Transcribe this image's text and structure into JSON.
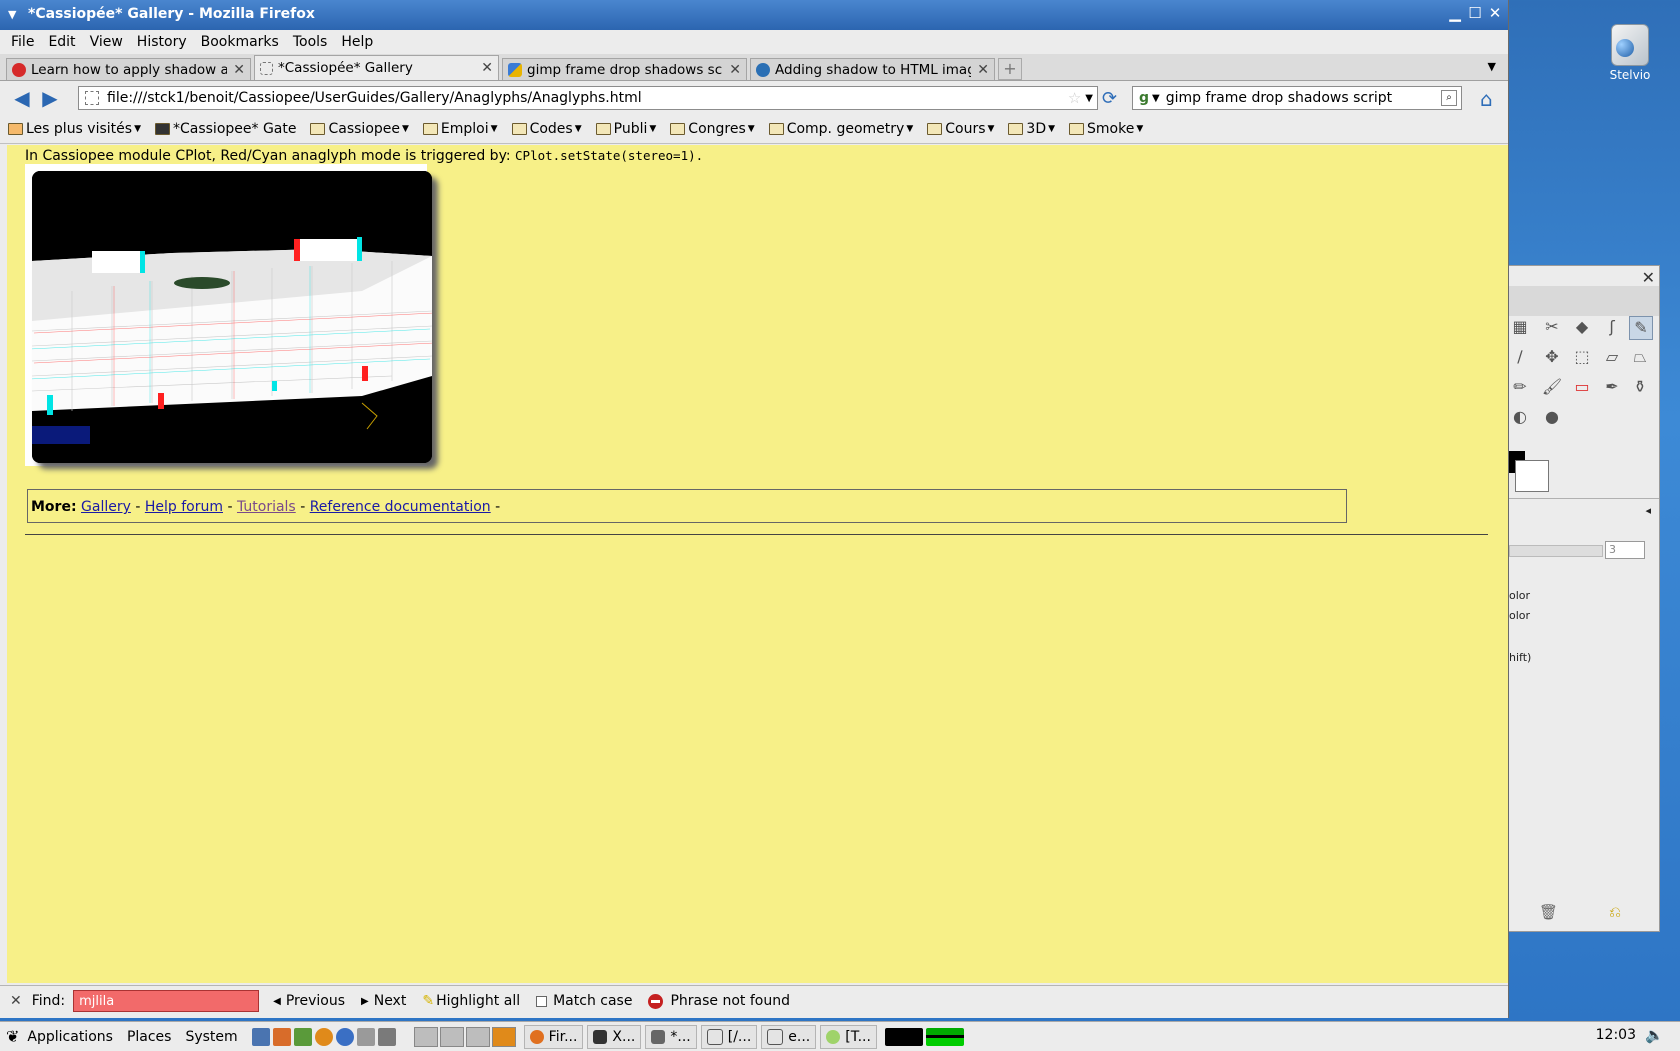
{
  "desktop": {
    "icon_label": "Stelvio"
  },
  "window": {
    "title": "*Cassiopée* Gallery - Mozilla Firefox"
  },
  "menu": [
    "File",
    "Edit",
    "View",
    "History",
    "Bookmarks",
    "Tools",
    "Help"
  ],
  "tabs": [
    {
      "label": "Learn how to apply shadow a...",
      "color": "#d62a2a"
    },
    {
      "label": "*Cassiopée* Gallery",
      "color": "#ffffff"
    },
    {
      "label": "gimp frame drop shadows sc...",
      "color": "#3a7bd5"
    },
    {
      "label": "Adding shadow to HTML imag...",
      "color": "#2a6fb4"
    }
  ],
  "nav": {
    "url": "file:///stck1/benoit/Cassiopee/UserGuides/Gallery/Anaglyphs/Anaglyphs.html",
    "search_query": "gimp frame drop shadows script"
  },
  "bookmarks": [
    "Les plus visités",
    "*Cassiopee* Gate",
    "Cassiopee",
    "Emploi",
    "Codes",
    "Publi",
    "Congres",
    "Comp. geometry",
    "Cours",
    "3D",
    "Smoke"
  ],
  "page": {
    "intro_text": "In Cassiopee module CPlot, Red/Cyan anaglyph mode is triggered by:",
    "intro_code": "CPlot.setState(stereo=1).",
    "more_label": "More:",
    "links": [
      "Gallery",
      "Help forum",
      "Tutorials",
      "Reference documentation"
    ],
    "sep": "-"
  },
  "findbar": {
    "find_label": "Find:",
    "query": "mjlila",
    "previous": "Previous",
    "next": "Next",
    "highlight": "Highlight all",
    "match_case": "Match case",
    "status": "Phrase not found"
  },
  "gimp": {
    "labels": [
      "olor",
      "olor",
      "hift)"
    ],
    "spin_value": "3"
  },
  "taskbar": {
    "menus": [
      "Applications",
      "Places",
      "System"
    ],
    "tasks": [
      "Fir...",
      "X...",
      "*...",
      "[/...",
      "e...",
      "[T..."
    ],
    "clock": "12:03"
  },
  "colors": {
    "page_bg": "#f7f088",
    "find_error": "#f26a6a",
    "link": "#1a1aa6"
  }
}
